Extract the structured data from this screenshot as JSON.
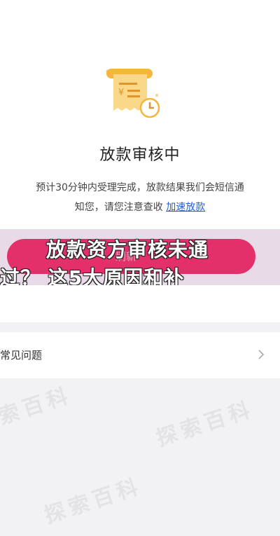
{
  "status": {
    "title": "放款审核中",
    "desc_line1": "预计30分钟内受理完成，放款结果我们会短信通",
    "desc_line2_prefix": "知您，请您注意查收",
    "speed_link": "加速放款"
  },
  "overlay": {
    "button_label": "刷新",
    "caption_line1": "放款资方审核未通",
    "caption_line2": "过？ 这5大原因和补"
  },
  "faq": {
    "label": "常见问题"
  },
  "watermark": {
    "text": "探索百科"
  },
  "colors": {
    "accent": "#e3306a",
    "link": "#2a5bd7",
    "illustration": "#f5b63b"
  },
  "icons": [
    "receipt-icon",
    "clock-icon",
    "chevron-right-icon"
  ]
}
